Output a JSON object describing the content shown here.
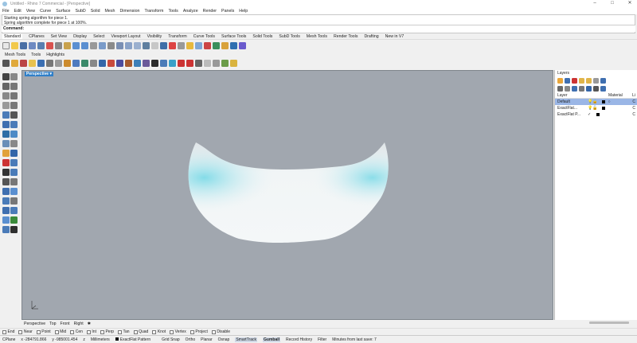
{
  "window": {
    "title": "Untitled - Rhino 7 Commercial - [Perspective]",
    "controls": [
      "–",
      "□",
      "✕"
    ]
  },
  "menu": [
    "File",
    "Edit",
    "View",
    "Curve",
    "Surface",
    "SubD",
    "Solid",
    "Mesh",
    "Dimension",
    "Transform",
    "Tools",
    "Analyze",
    "Render",
    "Panels",
    "Help"
  ],
  "command": {
    "history": [
      "Starting spring algorithm for piece 1.",
      "Spring algorithm complete for piece 1 at 100%."
    ],
    "prompt": "Command:"
  },
  "toolbar_tabs": [
    "Standard",
    "CPlanes",
    "Set View",
    "Display",
    "Select",
    "Viewport Layout",
    "Visibility",
    "Transform",
    "Curve Tools",
    "Surface Tools",
    "Solid Tools",
    "SubD Tools",
    "Mesh Tools",
    "Render Tools",
    "Drafting",
    "New in V7"
  ],
  "sub_tabs": [
    "Mesh Tools",
    "Tools",
    "Highlights"
  ],
  "viewport": {
    "title": "Perspective",
    "tabs": [
      "Perspective",
      "Top",
      "Front",
      "Right",
      "✱"
    ]
  },
  "layers_panel": {
    "title": "Layers",
    "col_layer": "Layer",
    "col_material": "Material",
    "col_linetype": "Li",
    "rows": [
      {
        "name": "Default",
        "current": false,
        "selected": true,
        "lt": "C"
      },
      {
        "name": "ExactFlat...",
        "current": false,
        "selected": false,
        "lt": "C"
      },
      {
        "name": "ExactFlat P...",
        "current": true,
        "selected": false,
        "lt": "C"
      }
    ]
  },
  "osnaps": [
    "End",
    "Near",
    "Point",
    "Mid",
    "Cen",
    "Int",
    "Perp",
    "Tan",
    "Quad",
    "Knot",
    "Vertex",
    "Project",
    "Disable"
  ],
  "status": {
    "cplane": "CPlane",
    "x": "x -284791.866",
    "y": "y -985001.454",
    "z": "z",
    "units": "Millimeters",
    "layer": "ExactFlat Pattern",
    "grid_snap": "Grid Snap",
    "ortho": "Ortho",
    "planar": "Planar",
    "osnap": "Osnap",
    "smarttrack": "SmartTrack",
    "gumball": "Gumball",
    "record_history": "Record History",
    "filter": "Filter",
    "minutes": "Minutes from last save: 7"
  },
  "colors": {
    "viewport_bg": "#a1a7af",
    "accent": "#2f7fc8",
    "selected_row": "#9ab6e6",
    "mesh_highlight": "#5fd3e3"
  }
}
